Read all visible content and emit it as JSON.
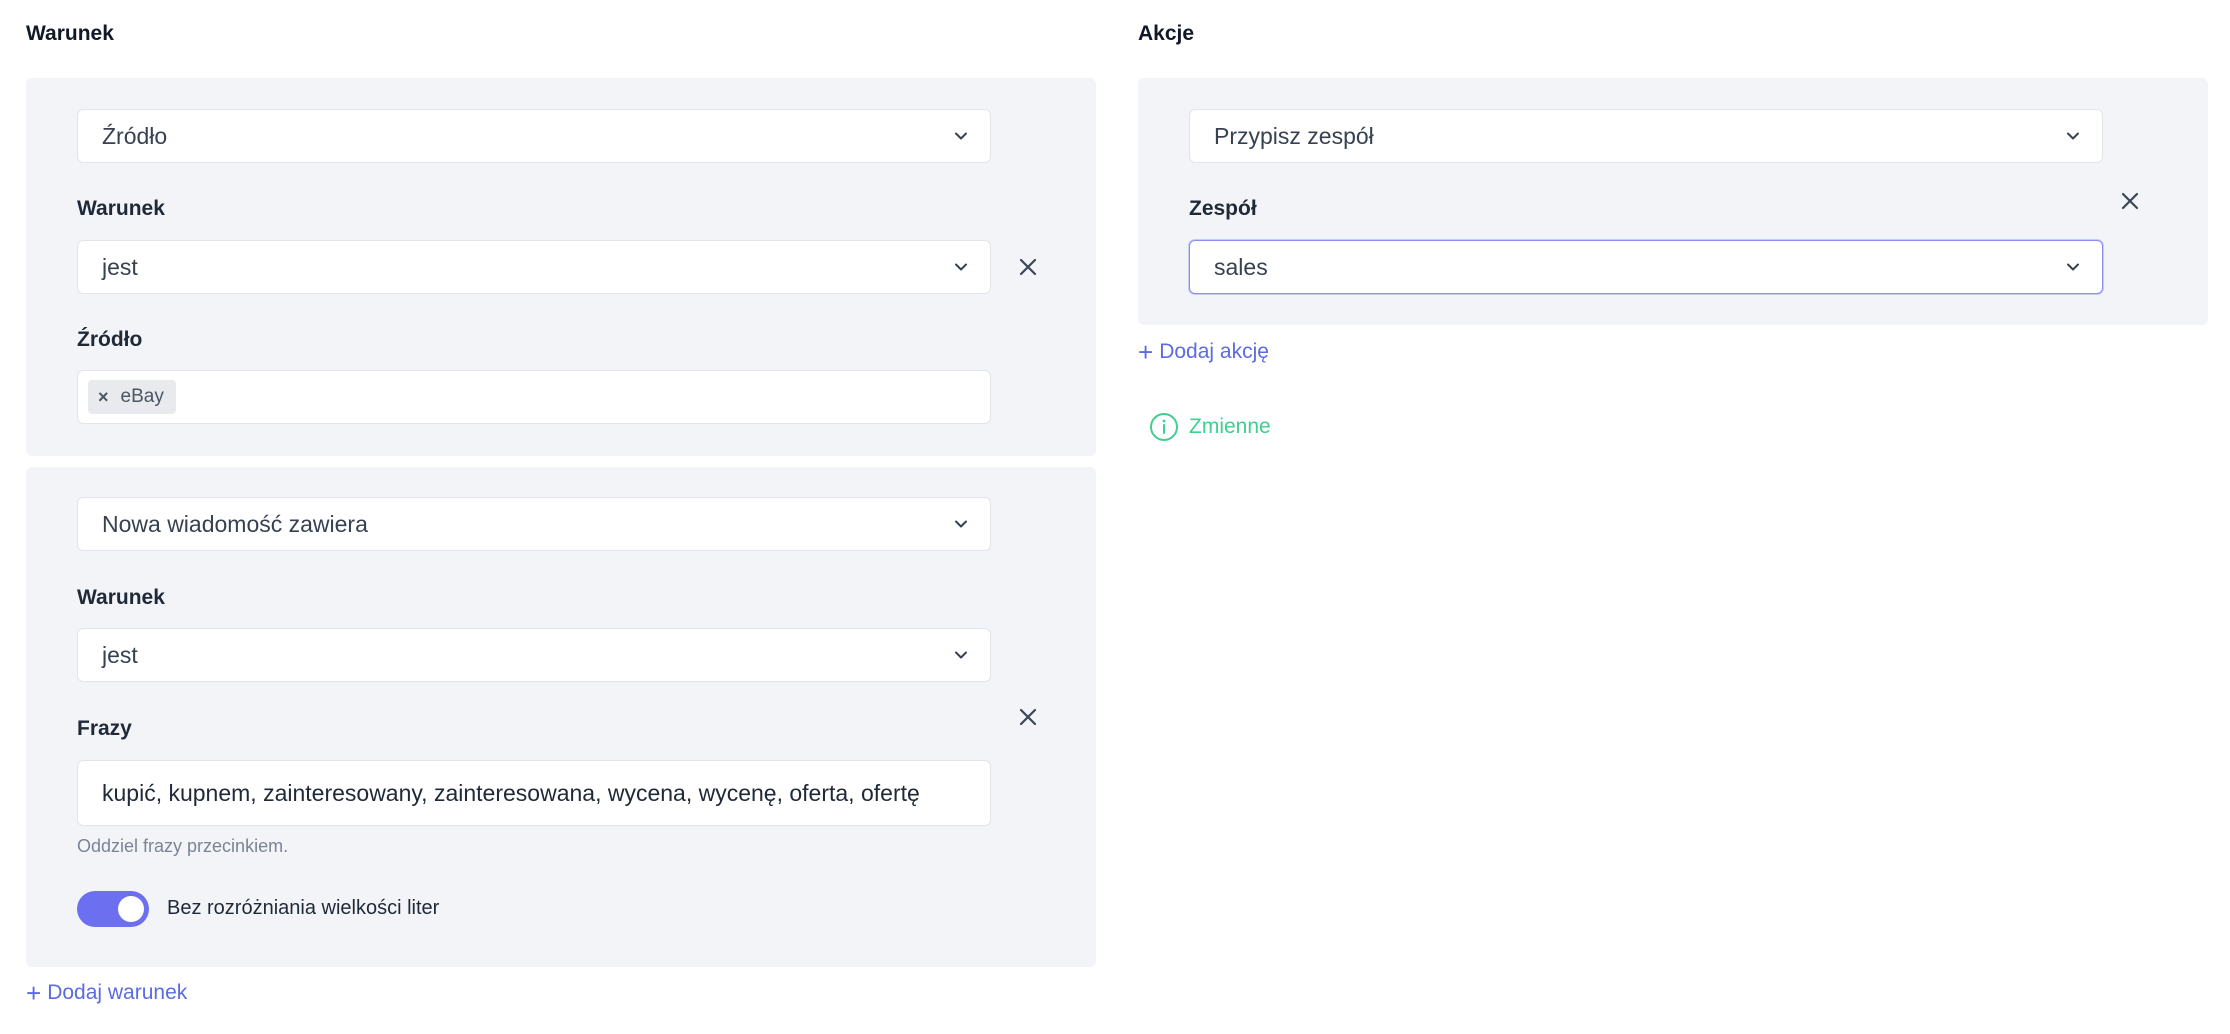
{
  "left": {
    "title": "Warunek",
    "condition1": {
      "type_select": "Źródło",
      "condition_label": "Warunek",
      "condition_select": "jest",
      "value_label": "Źródło",
      "tags": [
        "eBay"
      ]
    },
    "condition2": {
      "type_select": "Nowa wiadomość zawiera",
      "condition_label": "Warunek",
      "condition_select": "jest",
      "phrases_label": "Frazy",
      "phrases_value": "kupić, kupnem, zainteresowany, zainteresowana, wycena, wycenę, oferta, ofertę",
      "hint": "Oddziel frazy przecinkiem.",
      "toggle_label": "Bez rozróżniania wielkości liter",
      "toggle_on": true
    },
    "add_condition": "Dodaj warunek"
  },
  "right": {
    "title": "Akcje",
    "action1": {
      "type_select": "Przypisz zespół",
      "team_label": "Zespół",
      "team_select": "sales"
    },
    "add_action": "Dodaj akcję",
    "variables": "Zmienne"
  },
  "colors": {
    "accent": "#6b6ff0",
    "link": "#5b6be0",
    "variables": "#3fcf8e",
    "panel_bg": "#f3f4f8"
  },
  "icons": {
    "chevron": "chevron-down-icon",
    "close": "close-icon",
    "plus": "plus-icon",
    "info": "info-circle-icon"
  }
}
